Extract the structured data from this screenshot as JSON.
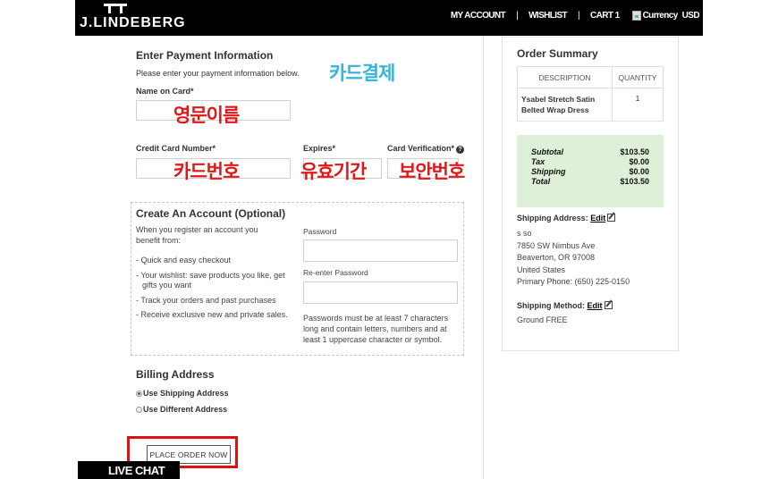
{
  "header": {
    "logo": "J.LINDEBERG",
    "nav": {
      "my_account": "MY ACCOUNT",
      "sep1": "|",
      "wishlist": "WISHLIST",
      "sep2": "|",
      "cart": "CART 1",
      "currency_alt": "Currency",
      "currency_value": "USD"
    }
  },
  "payment": {
    "title": "Enter Payment Information",
    "description": "Please enter your payment information below.",
    "name_label": "Name on Card*",
    "card_number_label": "Credit Card Number*",
    "expires_label": "Expires*",
    "verification_label": "Card Verification*",
    "help_icon": "?",
    "annotations": {
      "card_payment": "카드결제",
      "english_name": "영문이름",
      "card_number": "카드번호",
      "expiration": "유효기간",
      "security_code": "보안번호"
    }
  },
  "account": {
    "title": "Create An Account (Optional)",
    "intro": "When you register an account you benefit from:",
    "benefits": [
      "- Quick and easy checkout",
      "- Your wishlist: save products you like, get gifts you want",
      "- Track your orders and past purchases",
      "- Receive exclusive new and private sales."
    ],
    "password_label": "Password",
    "reenter_label": "Re-enter Password",
    "password_note": "Passwords must be at least 7 characters long and contain letters, numbers and at least 1 uppercase character or symbol."
  },
  "billing": {
    "title": "Billing Address",
    "options": [
      {
        "label": "Use Shipping Address",
        "checked": true
      },
      {
        "label": "Use Different Address",
        "checked": false
      }
    ]
  },
  "place_order_label": "PLACE ORDER NOW",
  "live_chat_label": "LIVE CHAT",
  "summary": {
    "title": "Order Summary",
    "col_description": "DESCRIPTION",
    "col_quantity": "QUANTITY",
    "item_name": "Ysabel Stretch Satin Belted Wrap Dress",
    "item_qty": "1",
    "totals": [
      {
        "label": "Subtotal",
        "value": "$103.50"
      },
      {
        "label": "Tax",
        "value": "$0.00"
      },
      {
        "label": "Shipping",
        "value": "$0.00"
      },
      {
        "label": "Total",
        "value": "$103.50"
      }
    ],
    "shipping_address_label": "Shipping Address:",
    "edit_label": "Edit",
    "address_lines": [
      "s so",
      "7850 SW Nimbus Ave",
      "Beaverton, OR 97008",
      "United States",
      "Primary Phone: (650) 225-0150"
    ],
    "shipping_method_label": "Shipping Method:",
    "shipping_method_value": "Ground FREE"
  },
  "colors": {
    "header_bg": "#000000",
    "annotation_blue": "#35b4d8",
    "annotation_red": "#e01818",
    "totals_bg": "#dff0d8",
    "highlight_red": "#e01010"
  }
}
